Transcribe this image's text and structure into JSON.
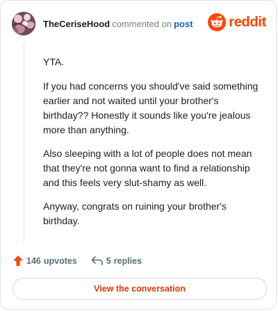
{
  "header": {
    "username": "TheCeriseHood",
    "commented_text": "commented on",
    "post_link": "post",
    "brand_word": "reddit"
  },
  "comment": {
    "paragraphs": [
      "YTA.",
      "If you had concerns you should've said something earlier and not waited until your brother's birthday?? Honestly it sounds like you're jealous more than anything.",
      "Also sleeping with a lot of people does not mean that they're not gonna want to find a relationship and this feels very slut-shamy as well.",
      "Anyway, congrats on ruining your brother's birthday."
    ]
  },
  "actions": {
    "upvotes_count": "146",
    "upvotes_label": "upvotes",
    "replies_count": "5",
    "replies_label": "replies"
  },
  "cta": {
    "label": "View the conversation"
  },
  "colors": {
    "brand": "#ff4500",
    "link": "#0a66c2",
    "cta_text": "#d93a00",
    "muted": "#576f76"
  }
}
